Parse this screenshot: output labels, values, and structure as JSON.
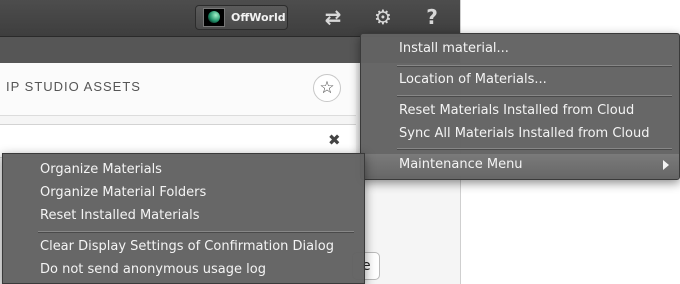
{
  "toolbar": {
    "scene_label": "OffWorld",
    "icons": [
      "swap-arrows-icon",
      "gear-icon",
      "help-icon"
    ],
    "swap_glyph": "⇄",
    "gear_glyph": "⚙",
    "help_glyph": "?"
  },
  "panel": {
    "title": "IP STUDIO ASSETS",
    "star_glyph": "☆",
    "clear_glyph": "✖",
    "partial_button_text": "e"
  },
  "main_menu": {
    "items": [
      {
        "label": "Install material..."
      },
      {
        "label": "Location of Materials..."
      },
      {
        "label": "Reset Materials Installed from Cloud"
      },
      {
        "label": "Sync All Materials Installed from Cloud"
      },
      {
        "label": "Maintenance Menu",
        "has_submenu": true,
        "highlighted": true
      }
    ]
  },
  "sub_menu": {
    "items": [
      {
        "label": "Organize Materials"
      },
      {
        "label": "Organize Material Folders"
      },
      {
        "label": "Reset Installed Materials"
      },
      {
        "label": "Clear Display Settings of Confirmation Dialog"
      },
      {
        "label": "Do not send anonymous usage log"
      }
    ]
  },
  "colors": {
    "menu_bg": "#626262",
    "menu_text": "#f4f4f4",
    "toolbar_bg": "#464646",
    "highlight": "#717171"
  }
}
